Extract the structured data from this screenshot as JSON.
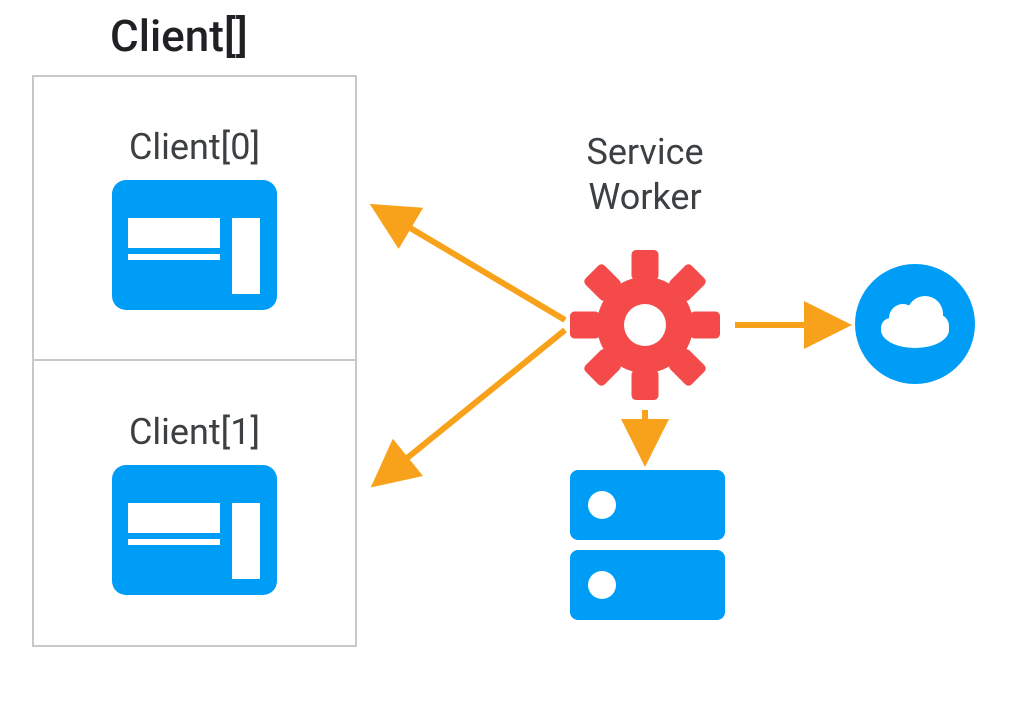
{
  "title": "Client[]",
  "clients": [
    {
      "label": "Client[0]"
    },
    {
      "label": "Client[1]"
    }
  ],
  "serviceWorker": {
    "label": "Service\nWorker"
  },
  "colors": {
    "blue": "#009df6",
    "red": "#f44a4a",
    "arrow": "#f8a21c",
    "border": "#c8c8c8",
    "text": "#3c4043"
  },
  "icons": {
    "client": "browser-window-icon",
    "serviceWorker": "gear-icon",
    "cache": "server-icon",
    "network": "cloud-icon"
  }
}
